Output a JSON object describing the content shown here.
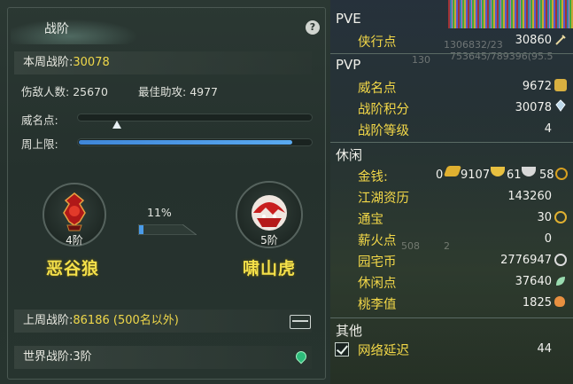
{
  "left": {
    "title": "战阶",
    "help_glyph": "?",
    "weekly_rank_label": "本周战阶:",
    "weekly_rank_value": "30078",
    "kills_label": "伤敌人数:",
    "kills_value": "25670",
    "best_assist_label": "最佳助攻:",
    "best_assist_value": "4977",
    "prestige_label": "威名点:",
    "prestige_fraction": 0.17,
    "weekly_cap_label": "周上限:",
    "weekly_cap_fraction": 0.92,
    "current_tier": {
      "tier": "4阶",
      "faction": "恶谷狼"
    },
    "next_tier": {
      "tier": "5阶",
      "faction": "啸山虎"
    },
    "tier_progress_label": "11%",
    "tier_progress": 0.11,
    "last_week_label": "上周战阶:",
    "last_week_value": "86186 (500名以外)",
    "world_rank_label": "世界战阶:",
    "world_rank_value": "3阶"
  },
  "right": {
    "faded_numbers": [
      "1306832/23",
      "130",
      "753645/789396(95.5"
    ],
    "pve": {
      "header": "PVE",
      "items": [
        {
          "label": "侠行点",
          "value": "30860",
          "icon": "sword-icon"
        }
      ]
    },
    "pvp": {
      "header": "PVP",
      "items": [
        {
          "label": "威名点",
          "value": "9672",
          "icon": "mask-icon"
        },
        {
          "label": "战阶积分",
          "value": "30078",
          "icon": "crystal-icon"
        },
        {
          "label": "战阶等级",
          "value": "4"
        }
      ]
    },
    "leisure": {
      "header": "休闲",
      "money_label": "金钱:",
      "money": {
        "gold_bar": "0",
        "gold": "9107",
        "silver": "61",
        "copper": "58"
      },
      "items": [
        {
          "label": "江湖资历",
          "value": "143260"
        },
        {
          "label": "通宝",
          "value": "30",
          "icon": "coin-icon"
        },
        {
          "label": "薪火点",
          "value": "0"
        },
        {
          "label": "园宅币",
          "value": "2776947",
          "icon": "house-coin-icon"
        },
        {
          "label": "休闲点",
          "value": "37640",
          "icon": "leaf-icon"
        },
        {
          "label": "桃李值",
          "value": "1825",
          "icon": "peach-icon"
        }
      ],
      "faded_counts": [
        "508",
        "2"
      ]
    },
    "other": {
      "header": "其他",
      "network_label": "网络延迟",
      "network_value": "44",
      "network_checked": true
    }
  },
  "colors": {
    "accent_yellow": "#f0d84a",
    "bar_blue": "#4a9be8",
    "panel": "#27342f"
  }
}
